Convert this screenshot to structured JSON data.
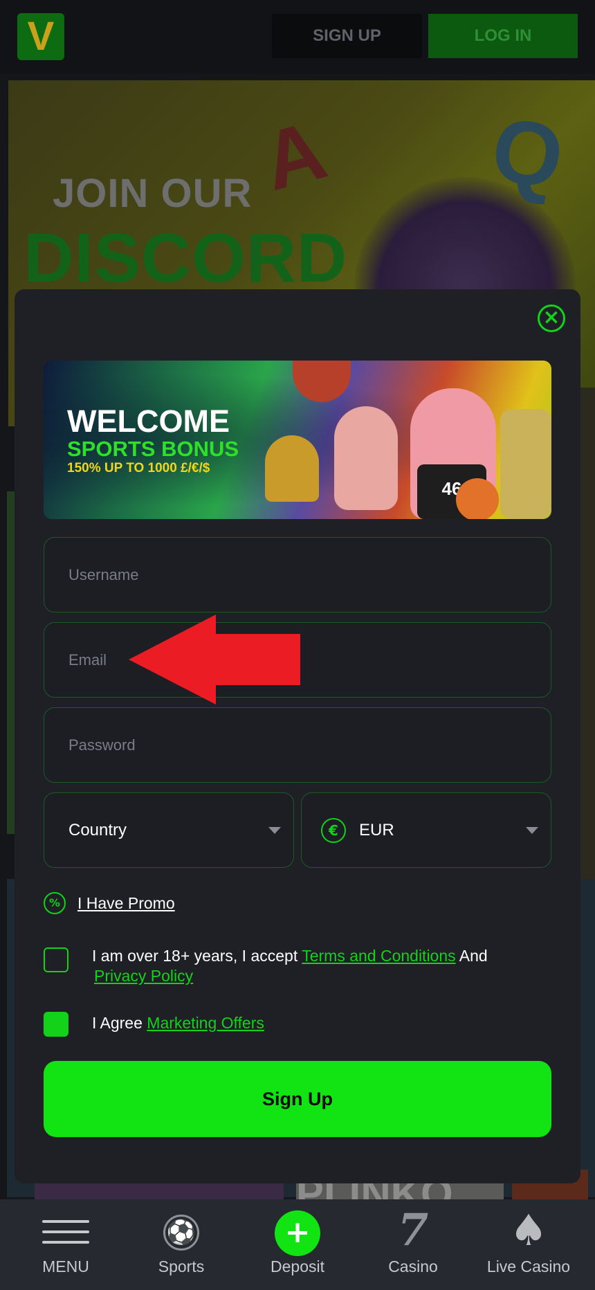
{
  "header": {
    "logo_letter": "V",
    "signup_label": "SIGN UP",
    "login_label": "LOG IN"
  },
  "background": {
    "banner_line1": "JOIN OUR",
    "banner_line2": "DISCORD",
    "tile_text": "PLINKO"
  },
  "modal": {
    "close_icon": "close-icon",
    "promo_banner": {
      "welcome": "WELCOME",
      "sports_bonus": "SPORTS BONUS",
      "offer": "150% UP TO 1000 £/€/$",
      "jersey_number": "46"
    },
    "username_placeholder": "Username",
    "email_placeholder": "Email",
    "password_placeholder": "Password",
    "country_value": "Country",
    "currency_symbol": "€",
    "currency_value": "EUR",
    "promo_link": "I Have Promo",
    "terms": {
      "prefix": "I am over 18+ years, I accept ",
      "terms_link": "Terms and Conditions",
      "and": " And ",
      "privacy_link": "Privacy Policy",
      "checked": false
    },
    "marketing": {
      "prefix": "I Agree ",
      "link": "Marketing Offers",
      "checked": true
    },
    "signup_button": "Sign Up"
  },
  "bottom_nav": {
    "items": [
      {
        "label": "MENU",
        "icon": "hamburger-icon"
      },
      {
        "label": "Sports",
        "icon": "soccer-ball-icon"
      },
      {
        "label": "Deposit",
        "icon": "plus-icon"
      },
      {
        "label": "Casino",
        "icon": "seven-icon"
      },
      {
        "label": "Live Casino",
        "icon": "spade-icon"
      }
    ]
  },
  "colors": {
    "accent": "#12e312",
    "modal_bg": "#1e2026",
    "arrow": "#ec1c24"
  }
}
